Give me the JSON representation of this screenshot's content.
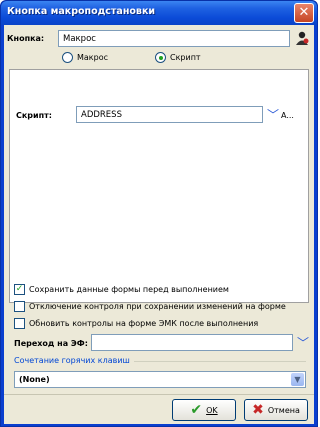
{
  "window": {
    "title": "Кнопка макроподстановки"
  },
  "button_field": {
    "label": "Кнопка:",
    "value": "Макрос"
  },
  "type_radio": [
    {
      "label": "Макрос",
      "checked": false
    },
    {
      "label": "Скрипт",
      "checked": true
    }
  ],
  "script_field": {
    "label": "Скрипт:",
    "value": "ADDRESS",
    "button_label": "A..."
  },
  "checkboxes": [
    {
      "label": "Сохранить данные формы перед выполнением",
      "checked": true
    },
    {
      "label": "Отключение контроля при сохранении изменений на форме",
      "checked": false
    },
    {
      "label": "Обновить контролы на форме ЭМК после выполнения",
      "checked": false
    }
  ],
  "goto_field": {
    "label": "Переход на ЭФ:",
    "value": ""
  },
  "hotkeys": {
    "group_title": "Сочетание горячих клавиш",
    "value": "(None)"
  },
  "buttons": {
    "ok_label": "OK",
    "cancel_label": "Отмена"
  },
  "colors": {
    "title_bar": "#0b4bd8",
    "dialog_bg": "#ece9d8",
    "group_title": "#0046d5"
  }
}
